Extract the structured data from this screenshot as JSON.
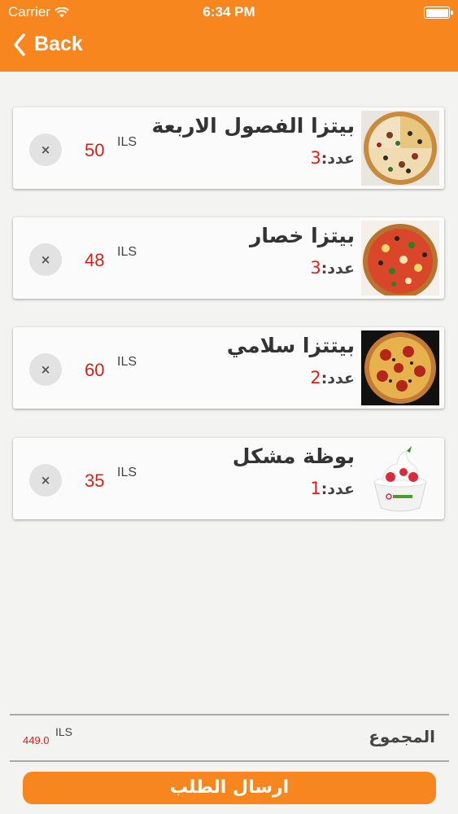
{
  "status_bar": {
    "carrier": "Carrier",
    "time": "6:34 PM",
    "icons": [
      "wifi-icon",
      "battery-icon"
    ]
  },
  "nav": {
    "back_label": "Back",
    "back_icon": "chevron-left-icon"
  },
  "colors": {
    "accent": "#f7861e",
    "price": "#d9211b",
    "background": "#f3f3f1"
  },
  "cart": {
    "items": [
      {
        "name": "بيتزا الفصول الاربعة",
        "qty_label": "عدد:",
        "qty": "3",
        "currency": "ILS",
        "price": "50",
        "image": "four-seasons-pizza-photo",
        "remove_symbol": "×"
      },
      {
        "name": "بيتزا خصار",
        "qty_label": "عدد:",
        "qty": "3",
        "currency": "ILS",
        "price": "48",
        "image": "vegetable-pizza-photo",
        "remove_symbol": "×"
      },
      {
        "name": "بيتتزا سلامي",
        "qty_label": "عدد:",
        "qty": "2",
        "currency": "ILS",
        "price": "60",
        "image": "salami-pizza-photo",
        "remove_symbol": "×"
      },
      {
        "name": "بوظة مشكل",
        "qty_label": "عدد:",
        "qty": "1",
        "currency": "ILS",
        "price": "35",
        "image": "frozen-yogurt-photo",
        "remove_symbol": "×"
      }
    ]
  },
  "summary": {
    "total_label": "المجموع",
    "currency": "ILS",
    "total": "449.0"
  },
  "actions": {
    "submit_label": "ارسال الطلب"
  }
}
